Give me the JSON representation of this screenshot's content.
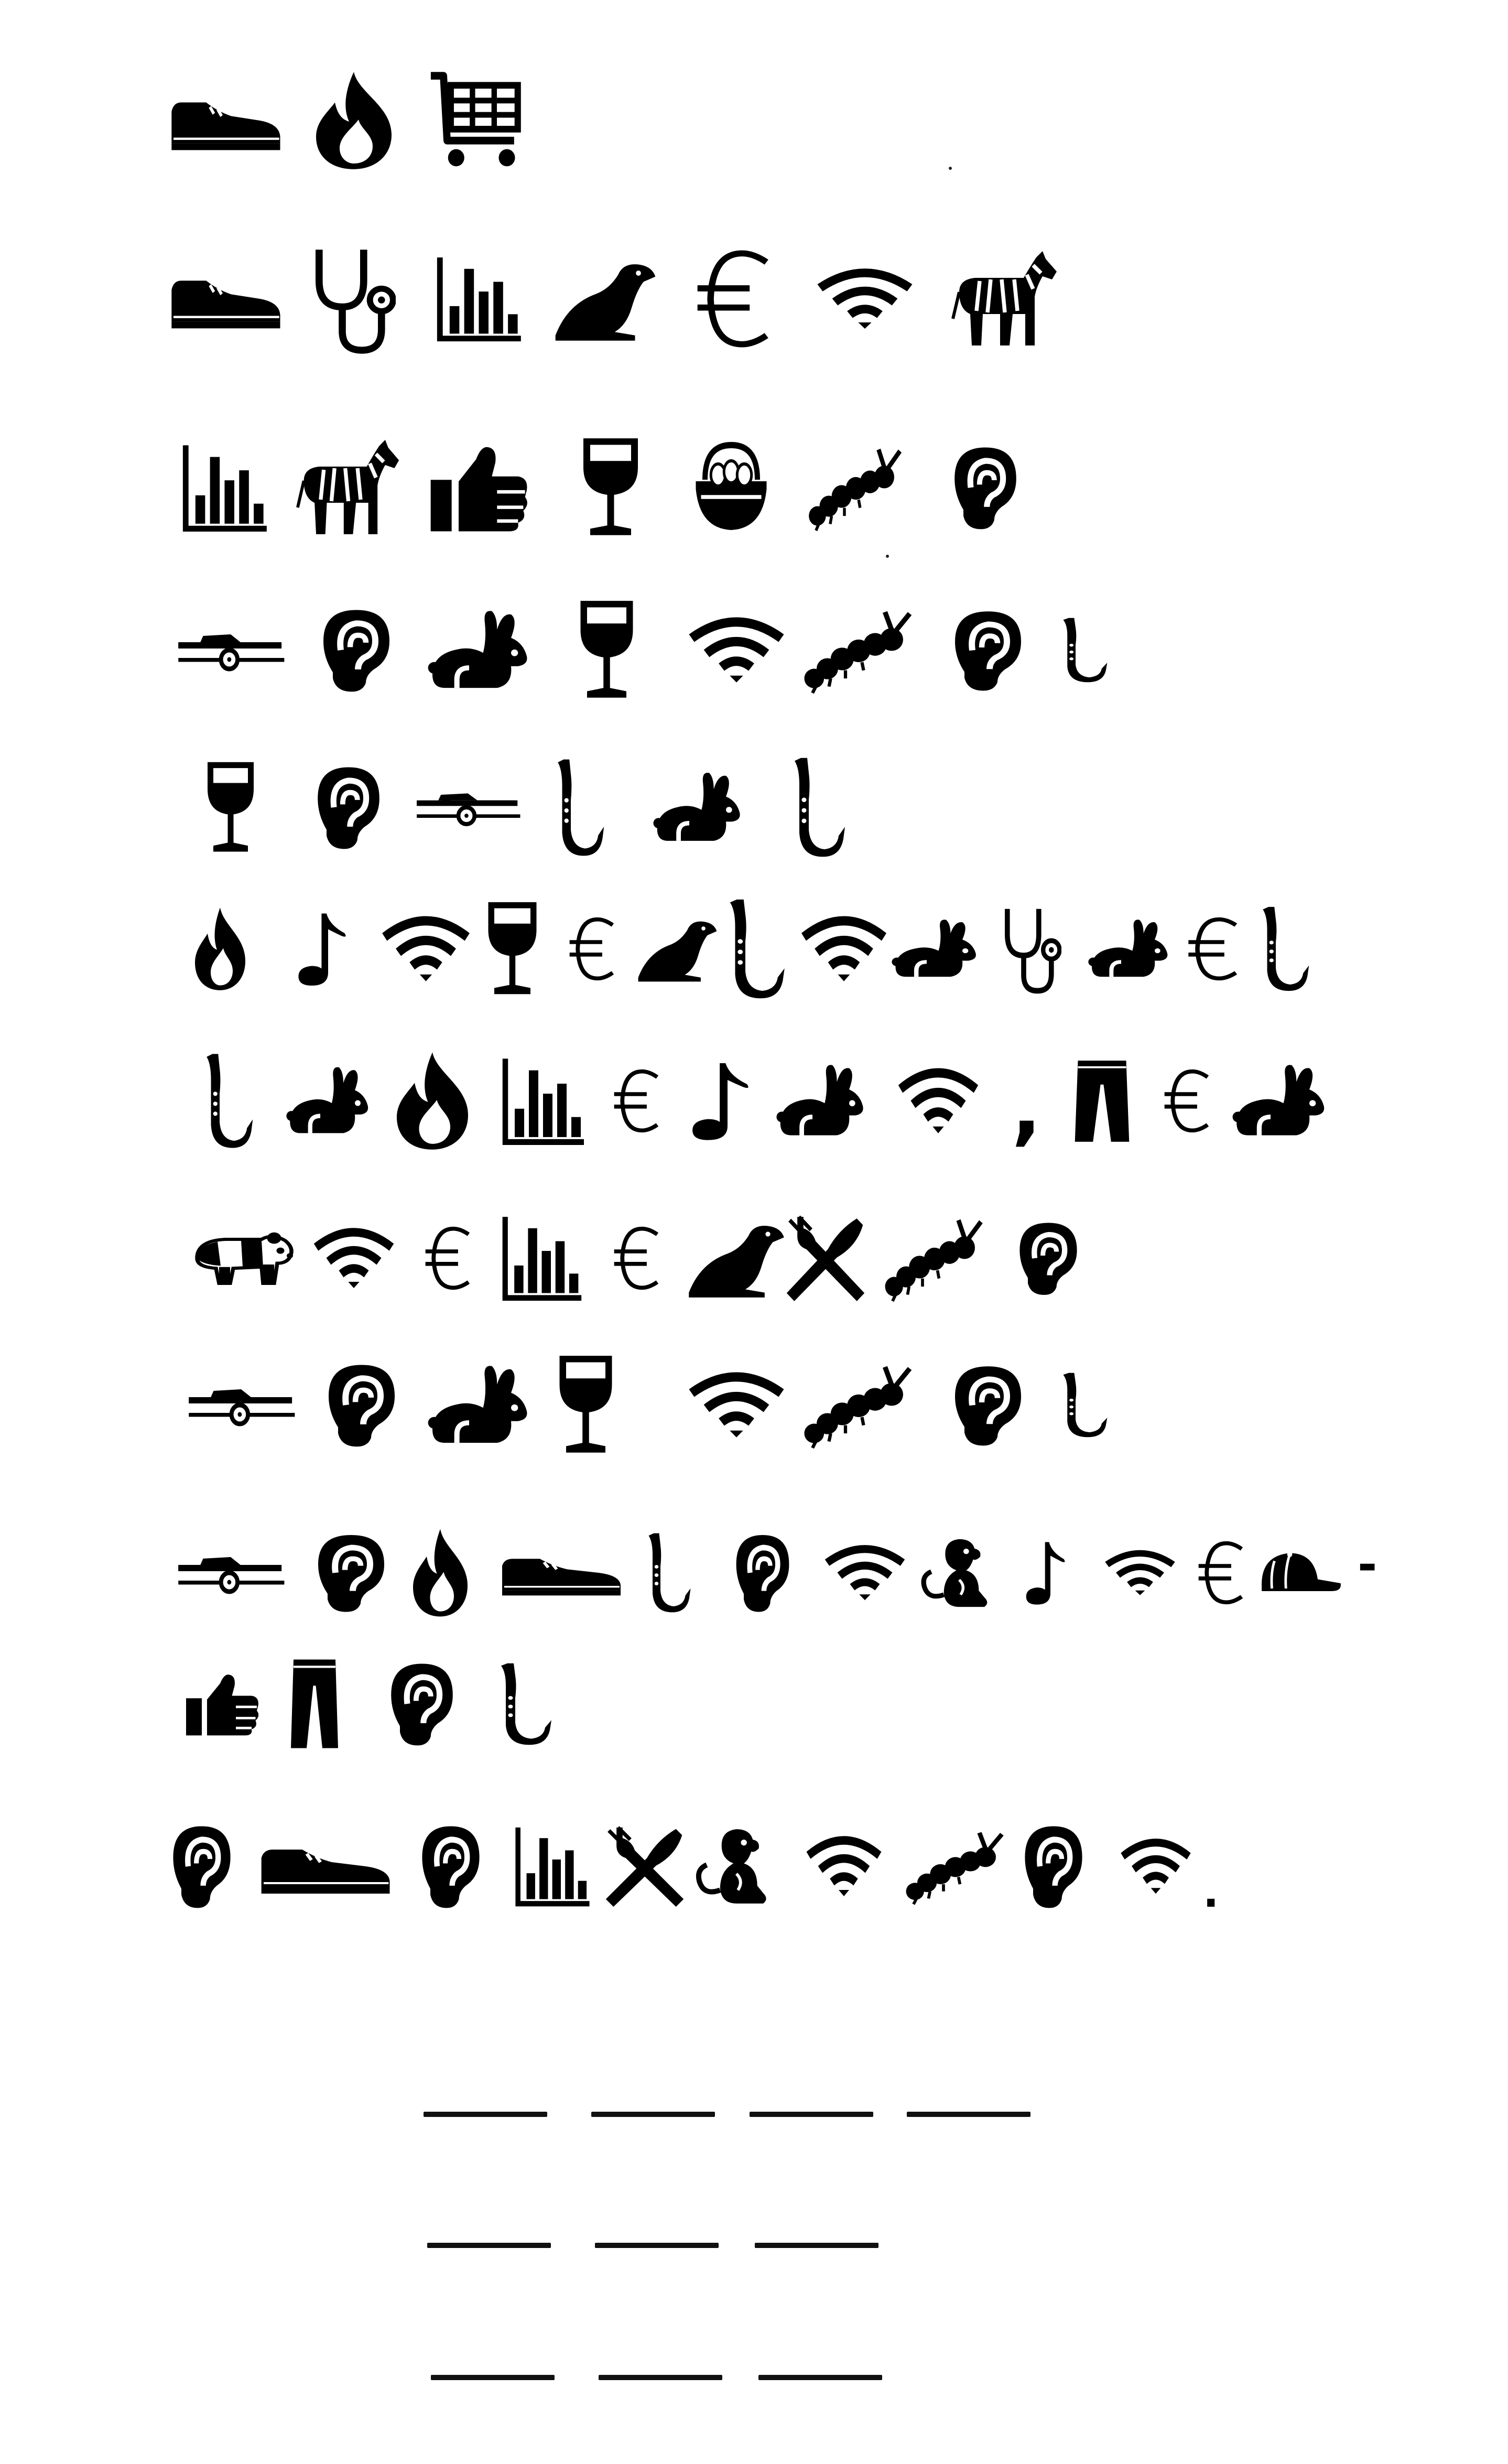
{
  "puzzle": {
    "rows": [
      [
        "shoe-icon",
        "fire-icon",
        "shopping-cart-icon"
      ],
      [
        "shoe-icon",
        "stethoscope-icon",
        "bar-chart-icon",
        "seal-icon",
        "euro-icon",
        "wifi-icon",
        "zebra-icon"
      ],
      [
        "bar-chart-icon",
        "zebra-icon",
        "thumbs-up-icon",
        "wine-glass-icon",
        "egg-basket-icon",
        "caterpillar-icon",
        "ear-icon"
      ],
      [
        "trailer-icon",
        "ear-icon",
        "rabbit-icon",
        "wine-glass-icon",
        "wifi-icon",
        "caterpillar-icon",
        "ear-icon",
        "saxophone-icon"
      ],
      [
        "wine-glass-icon",
        "ear-icon",
        "trailer-icon",
        "saxophone-icon",
        "rabbit-icon",
        "saxophone-icon"
      ],
      [
        "fire-icon",
        "music-note-icon",
        "wifi-icon",
        "wine-glass-icon",
        "euro-icon",
        "seal-icon",
        "saxophone-icon",
        "wifi-icon",
        "rabbit-icon",
        "stethoscope-icon",
        "rabbit-icon",
        "euro-icon",
        "saxophone-icon"
      ],
      [
        "saxophone-icon",
        "rabbit-icon",
        "fire-icon",
        "bar-chart-icon",
        "euro-icon",
        "music-note-icon",
        "rabbit-icon",
        "wifi-icon",
        "comma",
        "trousers-icon",
        "euro-icon",
        "rabbit-icon"
      ],
      [
        "panda-icon",
        "wifi-icon",
        "euro-icon",
        "bar-chart-icon",
        "euro-icon",
        "seal-icon",
        "fork-knife-icon",
        "caterpillar-icon",
        "ear-icon"
      ],
      [
        "trailer-icon",
        "ear-icon",
        "rabbit-icon",
        "wine-glass-icon",
        "wifi-icon",
        "caterpillar-icon",
        "ear-icon",
        "saxophone-icon"
      ],
      [
        "trailer-icon",
        "ear-icon",
        "fire-icon",
        "shoe-icon",
        "saxophone-icon",
        "ear-icon",
        "wifi-icon",
        "monkey-icon",
        "music-note-icon",
        "wifi-icon",
        "euro-icon",
        "cap-icon",
        "hyphen"
      ],
      [
        "thumbs-up-icon",
        "trousers-icon",
        "ear-icon",
        "saxophone-icon"
      ],
      [
        "ear-icon",
        "shoe-icon",
        "ear-icon",
        "bar-chart-icon",
        "fork-knife-icon",
        "monkey-icon",
        "wifi-icon",
        "caterpillar-icon",
        "ear-icon",
        "wifi-icon",
        "period"
      ]
    ],
    "punctuation": {
      "comma": ",",
      "hyphen": "-",
      "period": "."
    },
    "answer_blanks": [
      4,
      3,
      3
    ],
    "ink_color": "#000000",
    "background_color": "#ffffff"
  }
}
